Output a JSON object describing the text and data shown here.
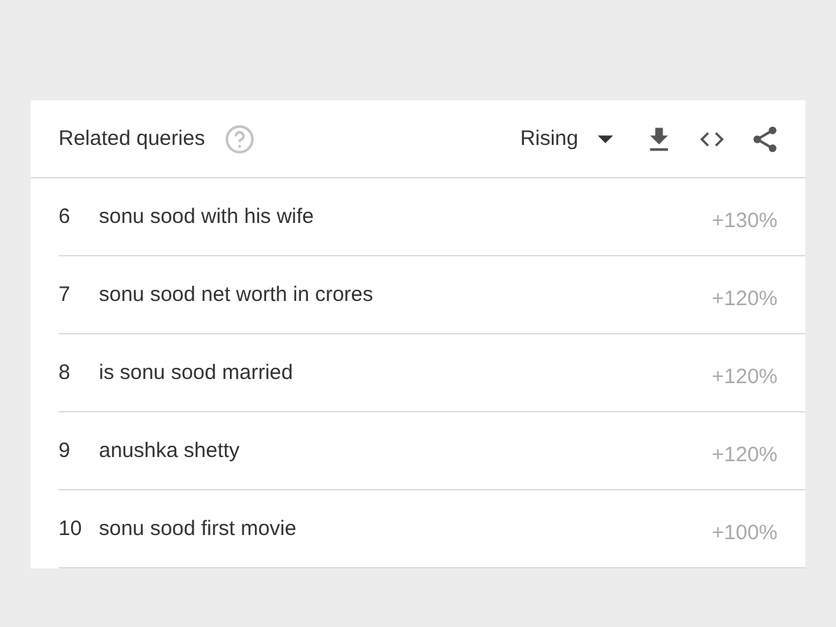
{
  "card": {
    "title": "Related queries",
    "filter": "Rising"
  },
  "rows": [
    {
      "rank": "6",
      "query": "sonu sood with his wife",
      "value": "+130%"
    },
    {
      "rank": "7",
      "query": "sonu sood net worth in crores",
      "value": "+120%"
    },
    {
      "rank": "8",
      "query": "is sonu sood married",
      "value": "+120%"
    },
    {
      "rank": "9",
      "query": "anushka shetty",
      "value": "+120%"
    },
    {
      "rank": "10",
      "query": "sonu sood first movie",
      "value": "+100%"
    }
  ]
}
